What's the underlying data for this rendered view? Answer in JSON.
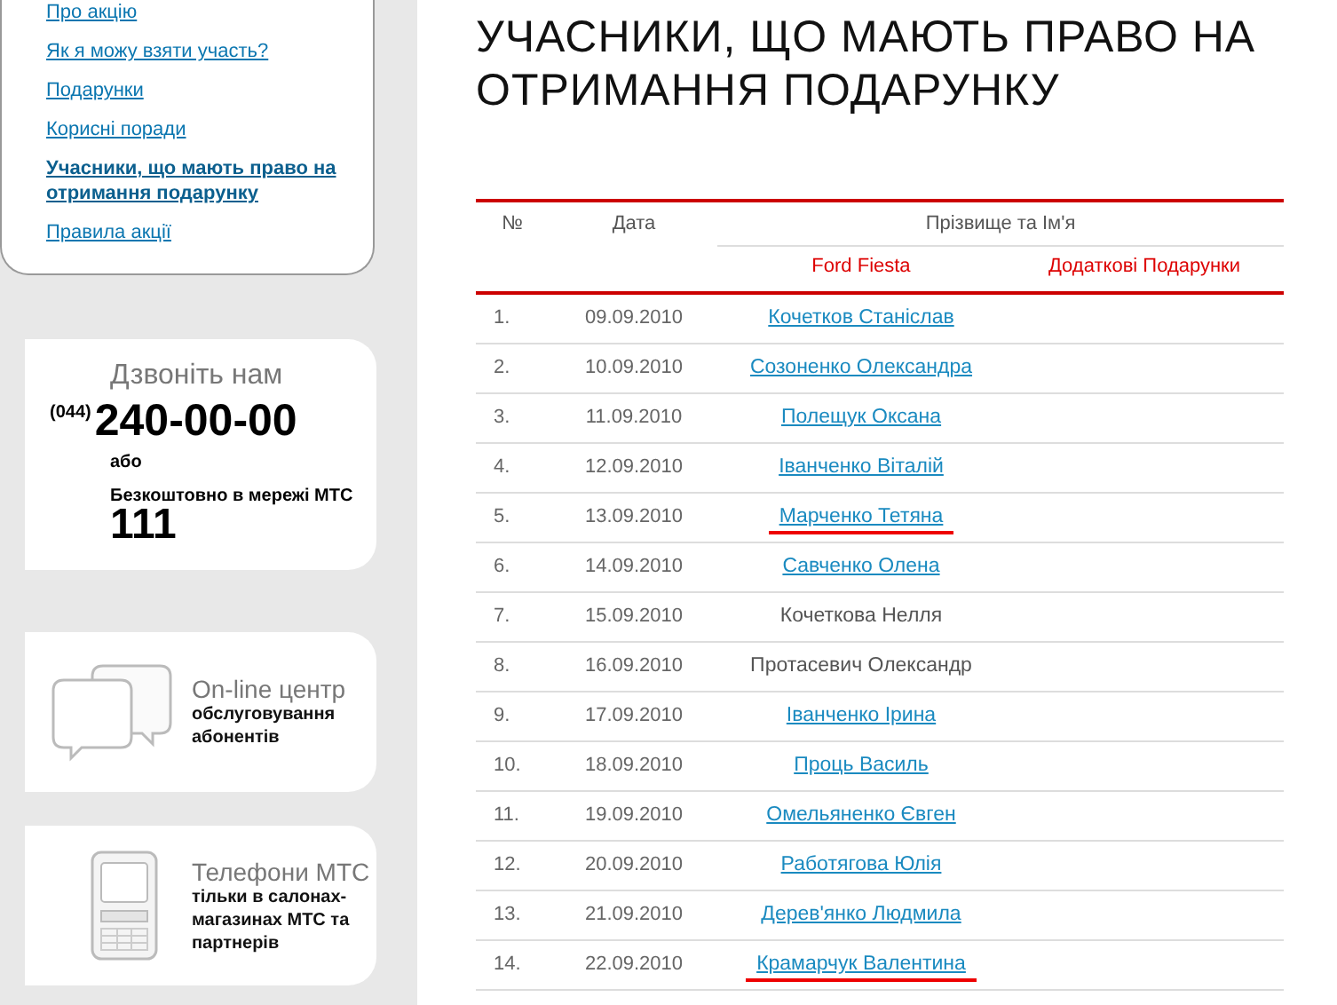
{
  "sidebar": {
    "nav": [
      {
        "label": "Про акцію",
        "selected": false
      },
      {
        "label": "Як я можу взяти участь?",
        "selected": false
      },
      {
        "label": "Подарунки",
        "selected": false
      },
      {
        "label": "Корисні поради",
        "selected": false
      },
      {
        "label": "Учасники, що мають право на отримання подарунку",
        "selected": true
      },
      {
        "label": "Правила акції",
        "selected": false
      }
    ],
    "call_card": {
      "title": "Дзвоніть нам",
      "area_code": "(044)",
      "phone": "240-00-00",
      "or": "або",
      "free_label": "Безкоштовно в мережі МТС",
      "short_number": "111"
    },
    "promo_cards": [
      {
        "kind": "chat",
        "title": "On-line центр",
        "text": "обслуговування абонентів"
      },
      {
        "kind": "phone",
        "title": "Телефони МТС",
        "text": "тільки в салонах-магазинах МТС та партнерів"
      }
    ]
  },
  "page_title": "УЧАСНИКИ, ЩО МАЮТЬ ПРАВО НА ОТРИМАННЯ ПОДАРУНКУ",
  "table": {
    "columns": {
      "number": "№",
      "date": "Дата",
      "name_group": "Прізвище та Ім'я",
      "prize_1": "Ford Fiesta",
      "prize_2": "Додаткові Подарунки"
    },
    "rows": [
      {
        "number": "1.",
        "date": "09.09.2010",
        "name": "Кочетков Станіслав",
        "linked": true,
        "marked": false
      },
      {
        "number": "2.",
        "date": "10.09.2010",
        "name": "Созоненко Олександра",
        "linked": true,
        "marked": false
      },
      {
        "number": "3.",
        "date": "11.09.2010",
        "name": "Полещук Оксана",
        "linked": true,
        "marked": false
      },
      {
        "number": "4.",
        "date": "12.09.2010",
        "name": "Іванченко Віталій",
        "linked": true,
        "marked": false
      },
      {
        "number": "5.",
        "date": "13.09.2010",
        "name": "Марченко Тетяна",
        "linked": true,
        "marked": true
      },
      {
        "number": "6.",
        "date": "14.09.2010",
        "name": "Савченко Олена",
        "linked": true,
        "marked": false
      },
      {
        "number": "7.",
        "date": "15.09.2010",
        "name": "Кочеткова Нелля",
        "linked": false,
        "marked": false
      },
      {
        "number": "8.",
        "date": "16.09.2010",
        "name": "Протасевич Олександр",
        "linked": false,
        "marked": false
      },
      {
        "number": "9.",
        "date": "17.09.2010",
        "name": "Іванченко Ірина",
        "linked": true,
        "marked": false
      },
      {
        "number": "10.",
        "date": "18.09.2010",
        "name": "Проць Василь",
        "linked": true,
        "marked": false
      },
      {
        "number": "11.",
        "date": "19.09.2010",
        "name": "Омельяненко Євген",
        "linked": true,
        "marked": false
      },
      {
        "number": "12.",
        "date": "20.09.2010",
        "name": "Работягова Юлія",
        "linked": true,
        "marked": false
      },
      {
        "number": "13.",
        "date": "21.09.2010",
        "name": "Дерев'янко Людмила",
        "linked": true,
        "marked": false
      },
      {
        "number": "14.",
        "date": "22.09.2010",
        "name": "Крамарчук Валентина",
        "linked": true,
        "marked": true
      }
    ]
  }
}
